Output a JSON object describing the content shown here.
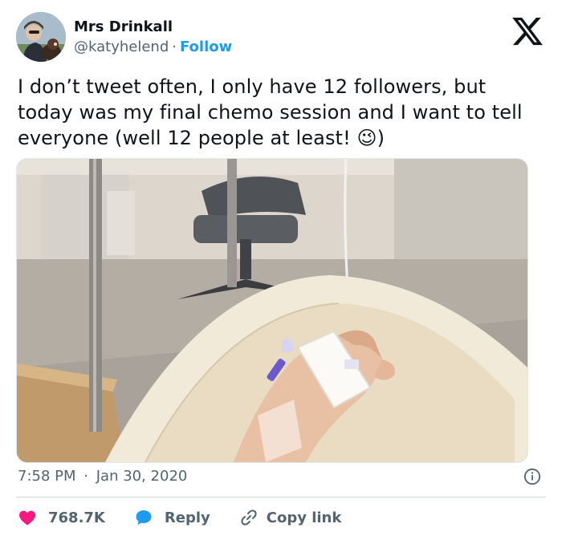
{
  "user": {
    "name": "Mrs Drinkall",
    "handle": "@katyhelend",
    "separator": "·",
    "follow_label": "Follow"
  },
  "tweet": {
    "text": "I don’t tweet often, I only have 12 followers, but today was my final chemo session and I want to tell everyone (well 12 people at least! 😉)"
  },
  "meta": {
    "time": "7:58 PM",
    "separator": "·",
    "date": "Jan 30, 2020"
  },
  "actions": {
    "likes": "768.7K",
    "reply_label": "Reply",
    "copy_label": "Copy link"
  },
  "icons": {
    "brand": "x-logo-icon",
    "like": "heart-icon",
    "reply": "speech-bubble-icon",
    "copy": "link-icon",
    "info": "info-icon"
  },
  "colors": {
    "link": "#1d9bf0",
    "like": "#f91880",
    "muted": "#536471",
    "text": "#0f1419"
  }
}
